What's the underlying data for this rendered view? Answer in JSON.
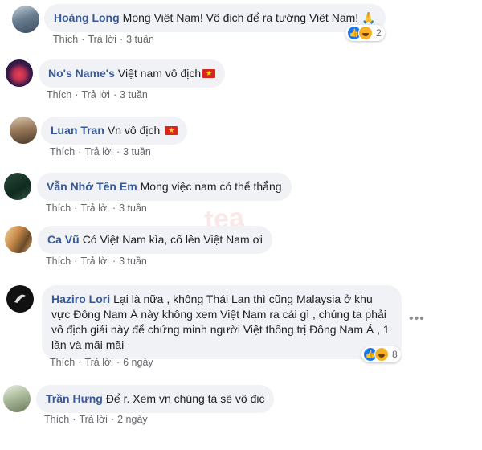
{
  "comments": [
    {
      "author": "Hoàng Long",
      "text": "Mong Việt Nam! Vô địch để ra tướng Việt Nam! 🙏",
      "flag": false,
      "actions": {
        "like": "Thích",
        "reply": "Trả lời",
        "time": "3 tuần"
      },
      "reactions": {
        "count": "2",
        "types": [
          "like-icon",
          "haha-icon"
        ]
      }
    },
    {
      "author": "No's Name's",
      "text": "Việt nam vô địch",
      "flag": true,
      "actions": {
        "like": "Thích",
        "reply": "Trả lời",
        "time": "3 tuần"
      }
    },
    {
      "author": "Luan Tran",
      "text": "Vn vô địch",
      "flag": true,
      "actions": {
        "like": "Thích",
        "reply": "Trả lời",
        "time": "3 tuần"
      }
    },
    {
      "author": "Vẫn Nhớ Tên Em",
      "text": "Mong việc nam có thể thắng",
      "flag": false,
      "actions": {
        "like": "Thích",
        "reply": "Trả lời",
        "time": "3 tuần"
      }
    },
    {
      "author": "Ca Vũ",
      "text": "Có Việt Nam kìa, cố lên Việt Nam ơi",
      "flag": false,
      "actions": {
        "like": "Thích",
        "reply": "Trả lời",
        "time": "3 tuần"
      }
    },
    {
      "author": "Haziro Lori",
      "text": "Lại là nữa , không Thái Lan thì cũng Malaysia ở khu vực Đông Nam Á này không xem Việt Nam ra cái gì , chúng ta phải vô địch giải này để chứng minh người Việt thống trị Đông Nam Á , 1 lần và mãi mãi",
      "flag": false,
      "actions": {
        "like": "Thích",
        "reply": "Trả lời",
        "time": "6 ngày"
      },
      "reactions": {
        "count": "8",
        "types": [
          "like-icon",
          "haha-icon"
        ]
      }
    },
    {
      "author": "Trần Hưng",
      "text": "Để r. Xem vn chúng ta sẽ vô đic",
      "flag": false,
      "actions": {
        "like": "Thích",
        "reply": "Trả lời",
        "time": "2 ngày"
      }
    }
  ],
  "avatar_colors": [
    "#7a8a9a",
    "#2b1a3a",
    "#8a6a4a",
    "#1e3a2a",
    "#7a5a2a",
    "#1a1a1a",
    "#b8c0a8"
  ],
  "more_icon": "more-dots-icon"
}
